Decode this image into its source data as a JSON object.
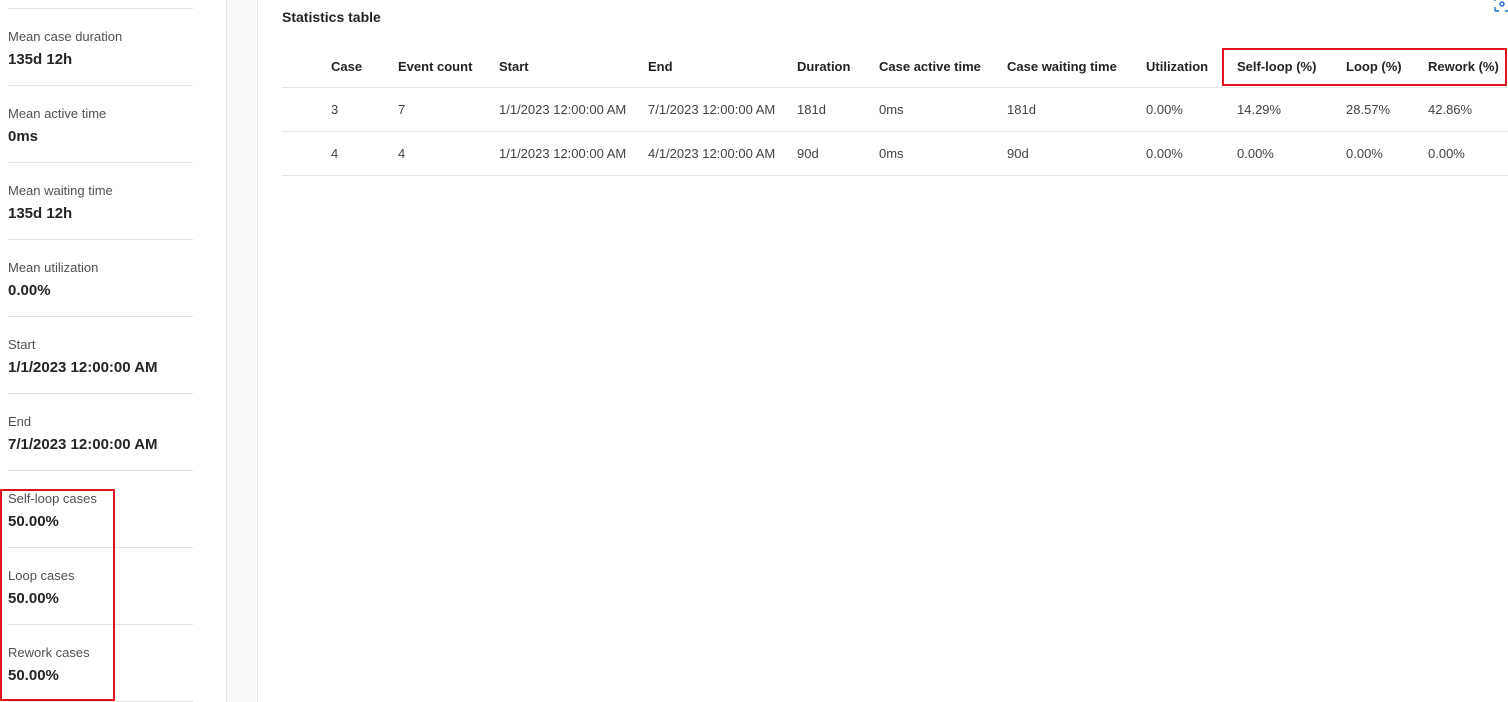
{
  "sidebar": {
    "stats": [
      {
        "label": "Mean case duration",
        "value": "135d 12h"
      },
      {
        "label": "Mean active time",
        "value": "0ms"
      },
      {
        "label": "Mean waiting time",
        "value": "135d 12h"
      },
      {
        "label": "Mean utilization",
        "value": "0.00%"
      },
      {
        "label": "Start",
        "value": "1/1/2023 12:00:00 AM"
      },
      {
        "label": "End",
        "value": "7/1/2023 12:00:00 AM"
      },
      {
        "label": "Self-loop cases",
        "value": "50.00%"
      },
      {
        "label": "Loop cases",
        "value": "50.00%"
      },
      {
        "label": "Rework cases",
        "value": "50.00%"
      }
    ]
  },
  "main": {
    "title": "Statistics table",
    "focus_icon": "focus-mode-icon",
    "table": {
      "columns": [
        "Case",
        "Event count",
        "Start",
        "End",
        "Duration",
        "Case active time",
        "Case waiting time",
        "Utilization",
        "Self-loop (%)",
        "Loop (%)",
        "Rework (%)"
      ],
      "rows": [
        [
          "3",
          "7",
          "1/1/2023 12:00:00 AM",
          "7/1/2023 12:00:00 AM",
          "181d",
          "0ms",
          "181d",
          "0.00%",
          "14.29%",
          "28.57%",
          "42.86%"
        ],
        [
          "4",
          "4",
          "1/1/2023 12:00:00 AM",
          "4/1/2023 12:00:00 AM",
          "90d",
          "0ms",
          "90d",
          "0.00%",
          "0.00%",
          "0.00%",
          "0.00%"
        ]
      ]
    }
  },
  "colors": {
    "highlight": "#e0141e",
    "accent": "#1a6fd1",
    "divider": "#e6e6e6"
  }
}
